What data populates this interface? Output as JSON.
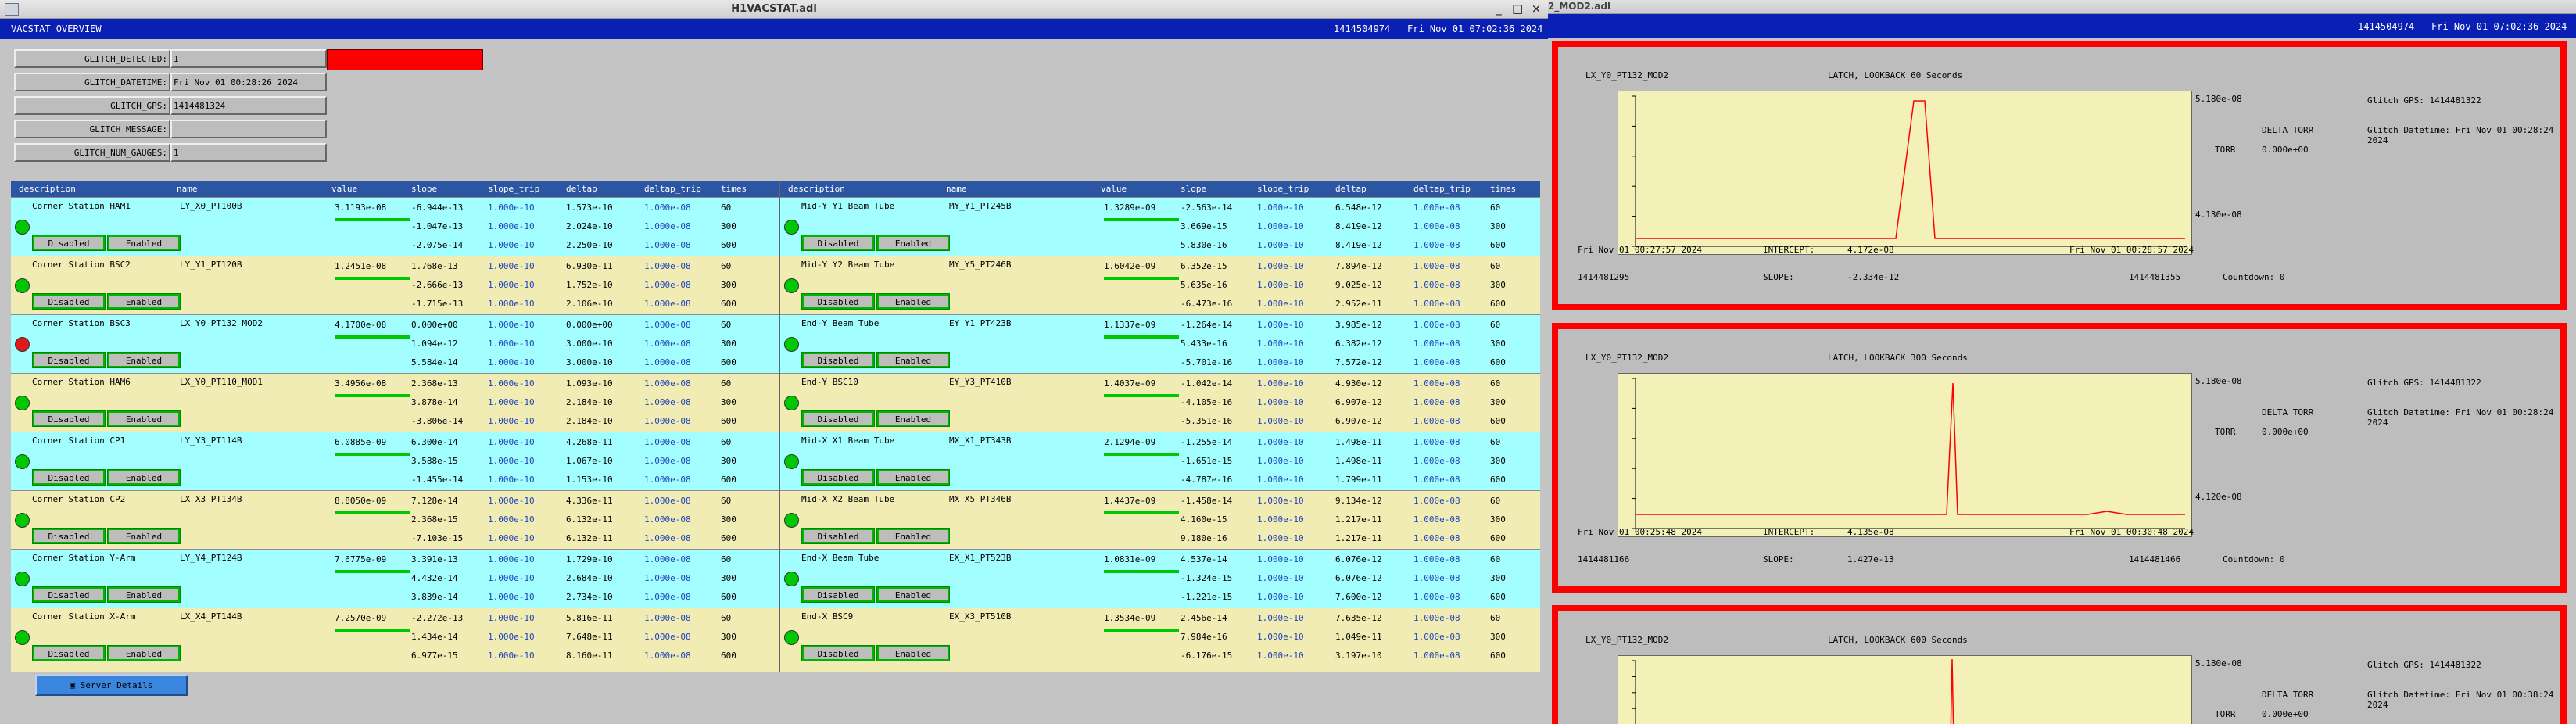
{
  "win1": {
    "title": "H1VACSTAT.adl",
    "header_left": "VACSTAT OVERVIEW",
    "header_gps": "1414504974",
    "header_time": "Fri Nov 01 07:02:36 2024",
    "controls": [
      "_",
      "□",
      "×"
    ]
  },
  "glitch": [
    {
      "label": "GLITCH_DETECTED:",
      "value": "1"
    },
    {
      "label": "GLITCH_DATETIME:",
      "value": "Fri Nov 01 00:28:26 2024"
    },
    {
      "label": "GLITCH_GPS:",
      "value": "1414481324"
    },
    {
      "label": "GLITCH_MESSAGE:",
      "value": ""
    },
    {
      "label": "GLITCH_NUM_GAUGES:",
      "value": "1"
    }
  ],
  "colors": {
    "alarm": "#ff0000",
    "ok": "#00c800",
    "header": "#0a1fb3"
  },
  "table_headers": [
    "description",
    "name",
    "value",
    "slope",
    "slope_trip",
    "deltap",
    "deltap_trip",
    "times"
  ],
  "buttons": {
    "disabled": "Disabled",
    "enabled": "Enabled",
    "server": "Server Details"
  },
  "left_rows": [
    {
      "desc": "Corner Station HAM1",
      "name": "LY_X0_PT100B",
      "value": "3.1193e-08",
      "status": "ok",
      "slope": [
        "-6.944e-13",
        "-1.047e-13",
        "-2.075e-14"
      ],
      "slope_trip": [
        "1.000e-10",
        "1.000e-10",
        "1.000e-10"
      ],
      "deltap": [
        "1.573e-10",
        "2.024e-10",
        "2.250e-10"
      ],
      "deltap_trip": [
        "1.000e-08",
        "1.000e-08",
        "1.000e-08"
      ],
      "times": [
        "60",
        "300",
        "600"
      ]
    },
    {
      "desc": "Corner Station BSC2",
      "name": "LY_Y1_PT120B",
      "value": "1.2451e-08",
      "status": "ok",
      "slope": [
        "1.768e-13",
        "-2.666e-13",
        "-1.715e-13"
      ],
      "slope_trip": [
        "1.000e-10",
        "1.000e-10",
        "1.000e-10"
      ],
      "deltap": [
        "6.930e-11",
        "1.752e-10",
        "2.106e-10"
      ],
      "deltap_trip": [
        "1.000e-08",
        "1.000e-08",
        "1.000e-08"
      ],
      "times": [
        "60",
        "300",
        "600"
      ]
    },
    {
      "desc": "Corner Station BSC3",
      "name": "LX_Y0_PT132_MOD2",
      "value": "4.1700e-08",
      "status": "alarm",
      "slope": [
        "0.000e+00",
        "1.094e-12",
        "5.584e-14"
      ],
      "slope_trip": [
        "1.000e-10",
        "1.000e-10",
        "1.000e-10"
      ],
      "deltap": [
        "0.000e+00",
        "3.000e-10",
        "3.000e-10"
      ],
      "deltap_trip": [
        "1.000e-08",
        "1.000e-08",
        "1.000e-08"
      ],
      "times": [
        "60",
        "300",
        "600"
      ]
    },
    {
      "desc": "Corner Station HAM6",
      "name": "LX_Y0_PT110_MOD1",
      "value": "3.4956e-08",
      "status": "ok",
      "slope": [
        "2.368e-13",
        "3.878e-14",
        "-3.806e-14"
      ],
      "slope_trip": [
        "1.000e-10",
        "1.000e-10",
        "1.000e-10"
      ],
      "deltap": [
        "1.093e-10",
        "2.184e-10",
        "2.184e-10"
      ],
      "deltap_trip": [
        "1.000e-08",
        "1.000e-08",
        "1.000e-08"
      ],
      "times": [
        "60",
        "300",
        "600"
      ]
    },
    {
      "desc": "Corner Station CP1",
      "name": "LY_Y3_PT114B",
      "value": "6.0885e-09",
      "status": "ok",
      "slope": [
        "6.300e-14",
        "3.588e-15",
        "-1.455e-14"
      ],
      "slope_trip": [
        "1.000e-10",
        "1.000e-10",
        "1.000e-10"
      ],
      "deltap": [
        "4.268e-11",
        "1.067e-10",
        "1.153e-10"
      ],
      "deltap_trip": [
        "1.000e-08",
        "1.000e-08",
        "1.000e-08"
      ],
      "times": [
        "60",
        "300",
        "600"
      ]
    },
    {
      "desc": "Corner Station CP2",
      "name": "LX_X3_PT134B",
      "value": "8.8050e-09",
      "status": "ok",
      "slope": [
        "7.128e-14",
        "2.368e-15",
        "-7.103e-15"
      ],
      "slope_trip": [
        "1.000e-10",
        "1.000e-10",
        "1.000e-10"
      ],
      "deltap": [
        "4.336e-11",
        "6.132e-11",
        "6.132e-11"
      ],
      "deltap_trip": [
        "1.000e-08",
        "1.000e-08",
        "1.000e-08"
      ],
      "times": [
        "60",
        "300",
        "600"
      ]
    },
    {
      "desc": "Corner Station Y-Arm",
      "name": "LY_Y4_PT124B",
      "value": "7.6775e-09",
      "status": "ok",
      "slope": [
        "3.391e-13",
        "4.432e-14",
        "3.839e-14"
      ],
      "slope_trip": [
        "1.000e-10",
        "1.000e-10",
        "1.000e-10"
      ],
      "deltap": [
        "1.729e-10",
        "2.684e-10",
        "2.734e-10"
      ],
      "deltap_trip": [
        "1.000e-08",
        "1.000e-08",
        "1.000e-08"
      ],
      "times": [
        "60",
        "300",
        "600"
      ]
    },
    {
      "desc": "Corner Station X-Arm",
      "name": "LX_X4_PT144B",
      "value": "7.2570e-09",
      "status": "ok",
      "slope": [
        "-2.272e-13",
        "1.434e-14",
        "6.977e-15"
      ],
      "slope_trip": [
        "1.000e-10",
        "1.000e-10",
        "1.000e-10"
      ],
      "deltap": [
        "5.816e-11",
        "7.648e-11",
        "8.160e-11"
      ],
      "deltap_trip": [
        "1.000e-08",
        "1.000e-08",
        "1.000e-08"
      ],
      "times": [
        "60",
        "300",
        "600"
      ]
    }
  ],
  "right_rows": [
    {
      "desc": "Mid-Y Y1 Beam Tube",
      "name": "MY_Y1_PT245B",
      "value": "1.3289e-09",
      "status": "ok",
      "slope": [
        "-2.563e-14",
        "3.669e-15",
        "5.830e-16"
      ],
      "slope_trip": [
        "1.000e-10",
        "1.000e-10",
        "1.000e-10"
      ],
      "deltap": [
        "6.548e-12",
        "8.419e-12",
        "8.419e-12"
      ],
      "deltap_trip": [
        "1.000e-08",
        "1.000e-08",
        "1.000e-08"
      ],
      "times": [
        "60",
        "300",
        "600"
      ]
    },
    {
      "desc": "Mid-Y Y2 Beam Tube",
      "name": "MY_Y5_PT246B",
      "value": "1.6042e-09",
      "status": "ok",
      "slope": [
        "6.352e-15",
        "5.635e-16",
        "-6.473e-16"
      ],
      "slope_trip": [
        "1.000e-10",
        "1.000e-10",
        "1.000e-10"
      ],
      "deltap": [
        "7.894e-12",
        "9.025e-12",
        "2.952e-11"
      ],
      "deltap_trip": [
        "1.000e-08",
        "1.000e-08",
        "1.000e-08"
      ],
      "times": [
        "60",
        "300",
        "600"
      ]
    },
    {
      "desc": "End-Y Beam Tube",
      "name": "EY_Y1_PT423B",
      "value": "1.1337e-09",
      "status": "ok",
      "slope": [
        "-1.264e-14",
        "5.433e-16",
        "-5.701e-16"
      ],
      "slope_trip": [
        "1.000e-10",
        "1.000e-10",
        "1.000e-10"
      ],
      "deltap": [
        "3.985e-12",
        "6.382e-12",
        "7.572e-12"
      ],
      "deltap_trip": [
        "1.000e-08",
        "1.000e-08",
        "1.000e-08"
      ],
      "times": [
        "60",
        "300",
        "600"
      ]
    },
    {
      "desc": "End-Y BSC10",
      "name": "EY_Y3_PT410B",
      "value": "1.4037e-09",
      "status": "ok",
      "slope": [
        "-1.042e-14",
        "-4.105e-16",
        "-5.351e-16"
      ],
      "slope_trip": [
        "1.000e-10",
        "1.000e-10",
        "1.000e-10"
      ],
      "deltap": [
        "4.930e-12",
        "6.907e-12",
        "6.907e-12"
      ],
      "deltap_trip": [
        "1.000e-08",
        "1.000e-08",
        "1.000e-08"
      ],
      "times": [
        "60",
        "300",
        "600"
      ]
    },
    {
      "desc": "Mid-X X1 Beam Tube",
      "name": "MX_X1_PT343B",
      "value": "2.1294e-09",
      "status": "ok",
      "slope": [
        "-1.255e-14",
        "-1.651e-15",
        "-4.787e-16"
      ],
      "slope_trip": [
        "1.000e-10",
        "1.000e-10",
        "1.000e-10"
      ],
      "deltap": [
        "1.498e-11",
        "1.498e-11",
        "1.799e-11"
      ],
      "deltap_trip": [
        "1.000e-08",
        "1.000e-08",
        "1.000e-08"
      ],
      "times": [
        "60",
        "300",
        "600"
      ]
    },
    {
      "desc": "Mid-X X2 Beam Tube",
      "name": "MX_X5_PT346B",
      "value": "1.4437e-09",
      "status": "ok",
      "slope": [
        "-1.458e-14",
        "4.160e-15",
        "9.180e-16"
      ],
      "slope_trip": [
        "1.000e-10",
        "1.000e-10",
        "1.000e-10"
      ],
      "deltap": [
        "9.134e-12",
        "1.217e-11",
        "1.217e-11"
      ],
      "deltap_trip": [
        "1.000e-08",
        "1.000e-08",
        "1.000e-08"
      ],
      "times": [
        "60",
        "300",
        "600"
      ]
    },
    {
      "desc": "End-X Beam Tube",
      "name": "EX_X1_PT523B",
      "value": "1.0831e-09",
      "status": "ok",
      "slope": [
        "4.537e-14",
        "-1.324e-15",
        "-1.221e-15"
      ],
      "slope_trip": [
        "1.000e-10",
        "1.000e-10",
        "1.000e-10"
      ],
      "deltap": [
        "6.076e-12",
        "6.076e-12",
        "7.600e-12"
      ],
      "deltap_trip": [
        "1.000e-08",
        "1.000e-08",
        "1.000e-08"
      ],
      "times": [
        "60",
        "300",
        "600"
      ]
    },
    {
      "desc": "End-X BSC9",
      "name": "EX_X3_PT510B",
      "value": "1.3534e-09",
      "status": "ok",
      "slope": [
        "2.456e-14",
        "7.984e-16",
        "-6.176e-15"
      ],
      "slope_trip": [
        "1.000e-10",
        "1.000e-10",
        "1.000e-10"
      ],
      "deltap": [
        "7.635e-12",
        "1.049e-11",
        "3.197e-10"
      ],
      "deltap_trip": [
        "1.000e-08",
        "1.000e-08",
        "1.000e-08"
      ],
      "times": [
        "60",
        "300",
        "600"
      ]
    }
  ],
  "win2": {
    "title": "2_MOD2.adl",
    "header_gps": "1414504974",
    "header_time": "Fri Nov 01 07:02:36 2024"
  },
  "panels": [
    {
      "gauge": "LX_Y0_PT132_MOD2",
      "caption": "LATCH, LOOKBACK 60 Seconds",
      "ymax": "5.180e-08",
      "ymin": "4.130e-08",
      "gps": "Glitch GPS: 1414481322",
      "delta_torr": "DELTA TORR",
      "torr": "TORR",
      "torr_val": "0.000e+00",
      "glitch_dt": "Glitch Datetime: Fri Nov 01 00:28:24 2024",
      "start_time": "Fri Nov 01 00:27:57 2024",
      "intercept_lbl": "INTERCEPT:",
      "intercept": "4.172e-08",
      "end_time": "Fri Nov 01 00:28:57 2024",
      "start_gps": "1414481295",
      "slope_lbl": "SLOPE:",
      "slope": "-2.334e-12",
      "end_gps": "1414481355",
      "countdown": "Countdown: 0"
    },
    {
      "gauge": "LX_Y0_PT132_MOD2",
      "caption": "LATCH, LOOKBACK 300 Seconds",
      "ymax": "5.180e-08",
      "ymin": "4.120e-08",
      "gps": "Glitch GPS: 1414481322",
      "delta_torr": "DELTA TORR",
      "torr": "TORR",
      "torr_val": "0.000e+00",
      "glitch_dt": "Glitch Datetime: Fri Nov 01 00:28:24 2024",
      "start_time": "Fri Nov 01 00:25:48 2024",
      "intercept_lbl": "INTERCEPT:",
      "intercept": "4.135e-08",
      "end_time": "Fri Nov 01 00:30:48 2024",
      "start_gps": "1414481166",
      "slope_lbl": "SLOPE:",
      "slope": "1.427e-13",
      "end_gps": "1414481466",
      "countdown": "Countdown: 0"
    },
    {
      "gauge": "LX_Y0_PT132_MOD2",
      "caption": "LATCH, LOOKBACK 600 Seconds",
      "ymax": "5.180e-08",
      "ymin": "",
      "gps": "Glitch GPS: 1414481322",
      "delta_torr": "DELTA TORR",
      "torr": "TORR",
      "torr_val": "0.000e+00",
      "glitch_dt": "Glitch Datetime: Fri Nov 01 00:38:24 2024",
      "start_time": "",
      "intercept_lbl": "",
      "intercept": "",
      "end_time": "",
      "start_gps": "",
      "slope_lbl": "",
      "slope": "",
      "end_gps": "",
      "countdown": ""
    }
  ]
}
